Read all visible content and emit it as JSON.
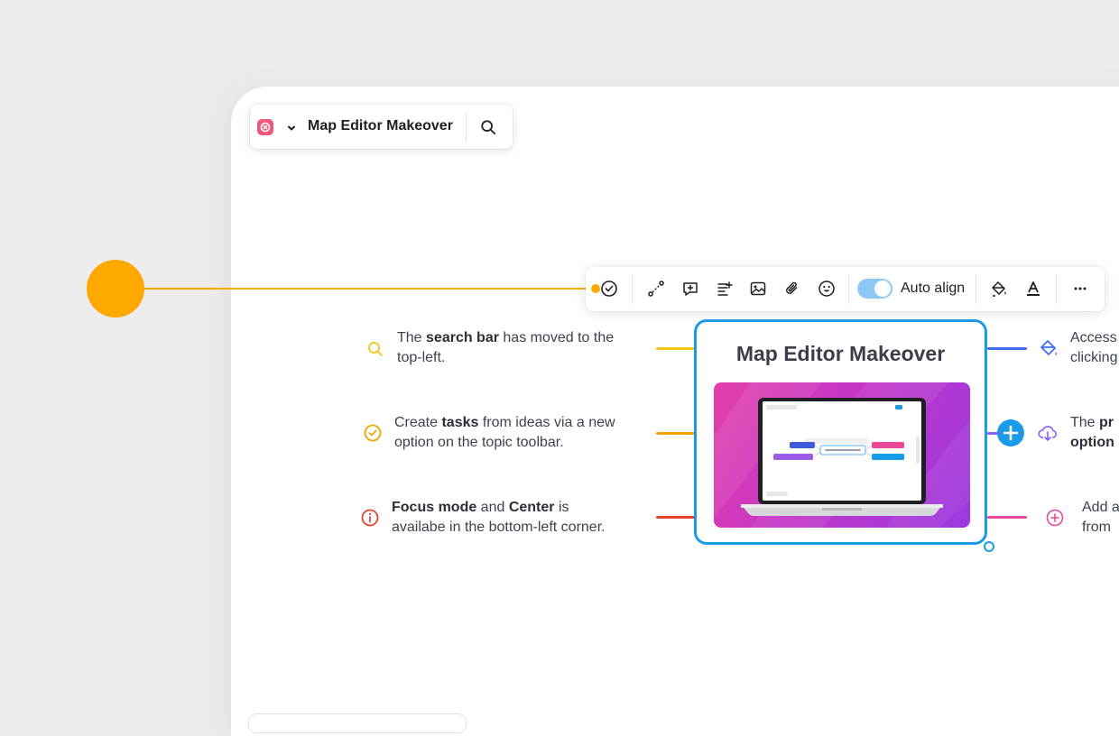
{
  "header": {
    "map_title": "Map Editor Makeover",
    "logo_icon": "app-logo-icon",
    "menu_icon": "chevron-down-icon",
    "search_icon": "search-icon"
  },
  "toolbar": {
    "tools": [
      "task-check-icon",
      "relationship-icon",
      "callout-icon",
      "notes-icon",
      "image-icon",
      "attachment-icon",
      "emoji-icon",
      "format-paint-icon",
      "text-color-icon",
      "more-icon"
    ],
    "auto_align_label": "Auto align",
    "auto_align_on": true
  },
  "central_topic": {
    "title": "Map Editor Makeover",
    "accent_color": "#1a9be6"
  },
  "notes_left": [
    {
      "pre": "The ",
      "bold": "search bar",
      "post": " has moved to the",
      "line2": "top-left.",
      "icon": "search-icon",
      "color": "#f5c518"
    },
    {
      "pre": "Create ",
      "bold": "tasks",
      "post": " from ideas via a new",
      "line2": "option on the topic toolbar.",
      "icon": "check-circle-icon",
      "color": "#f5a300"
    },
    {
      "bold": "Focus mode",
      "mid": " and ",
      "bold2": "Center",
      "post": " is",
      "line2": "availabe in the bottom-left corner.",
      "icon": "info-icon",
      "color": "#e8422c"
    }
  ],
  "notes_right": [
    {
      "line1": "Access",
      "line2": "clicking",
      "icon": "format-paint-icon",
      "color": "#3b6ef0"
    },
    {
      "pre": "The ",
      "bold": "pr",
      "line2_bold": "option",
      "icon": "cloud-download-icon",
      "color": "#8b5cf6"
    },
    {
      "line1": "Add a",
      "line2": "from",
      "icon": "plus-circle-icon",
      "color": "#ec4899"
    }
  ],
  "colors": {
    "orange": "#ffa800",
    "accent_blue": "#1a9be6"
  }
}
